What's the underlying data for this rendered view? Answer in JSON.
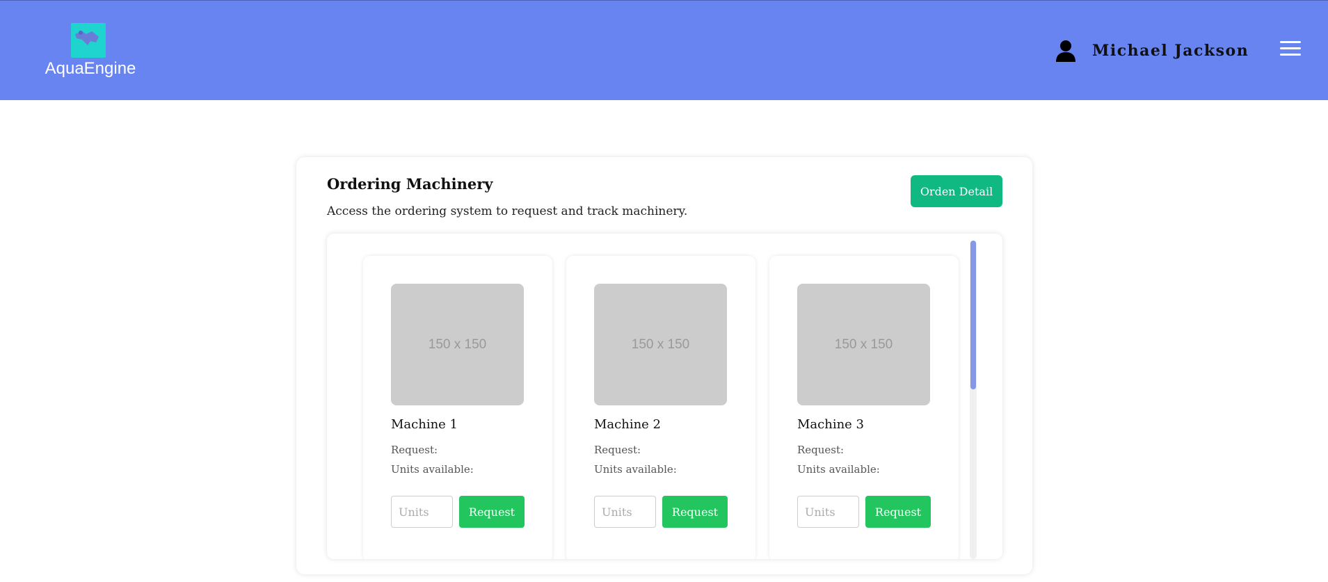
{
  "header": {
    "app_name": "AquaEngine",
    "user_name": "Michael Jackson",
    "colors": {
      "header_bg": "#6784f0",
      "logo_bg": "#1fd3cf"
    }
  },
  "panel": {
    "title": "Ordering Machinery",
    "description": "Access the ordering system to request and track machinery.",
    "order_detail_label": "Orden Detail"
  },
  "machines": [
    {
      "image_label": "150 x 150",
      "name": "Machine 1",
      "request_label": "Request:",
      "units_label": "Units available:",
      "units_placeholder": "Units",
      "button_label": "Request"
    },
    {
      "image_label": "150 x 150",
      "name": "Machine 2",
      "request_label": "Request:",
      "units_label": "Units available:",
      "units_placeholder": "Units",
      "button_label": "Request"
    },
    {
      "image_label": "150 x 150",
      "name": "Machine 3",
      "request_label": "Request:",
      "units_label": "Units available:",
      "units_placeholder": "Units",
      "button_label": "Request"
    }
  ],
  "icons": {
    "user": "user-icon",
    "menu": "hamburger-menu-icon",
    "logo": "map-logo-icon"
  },
  "accent_colors": {
    "primary": "#10b981",
    "request": "#22c55e",
    "scroll_thumb": "#8797e8"
  }
}
